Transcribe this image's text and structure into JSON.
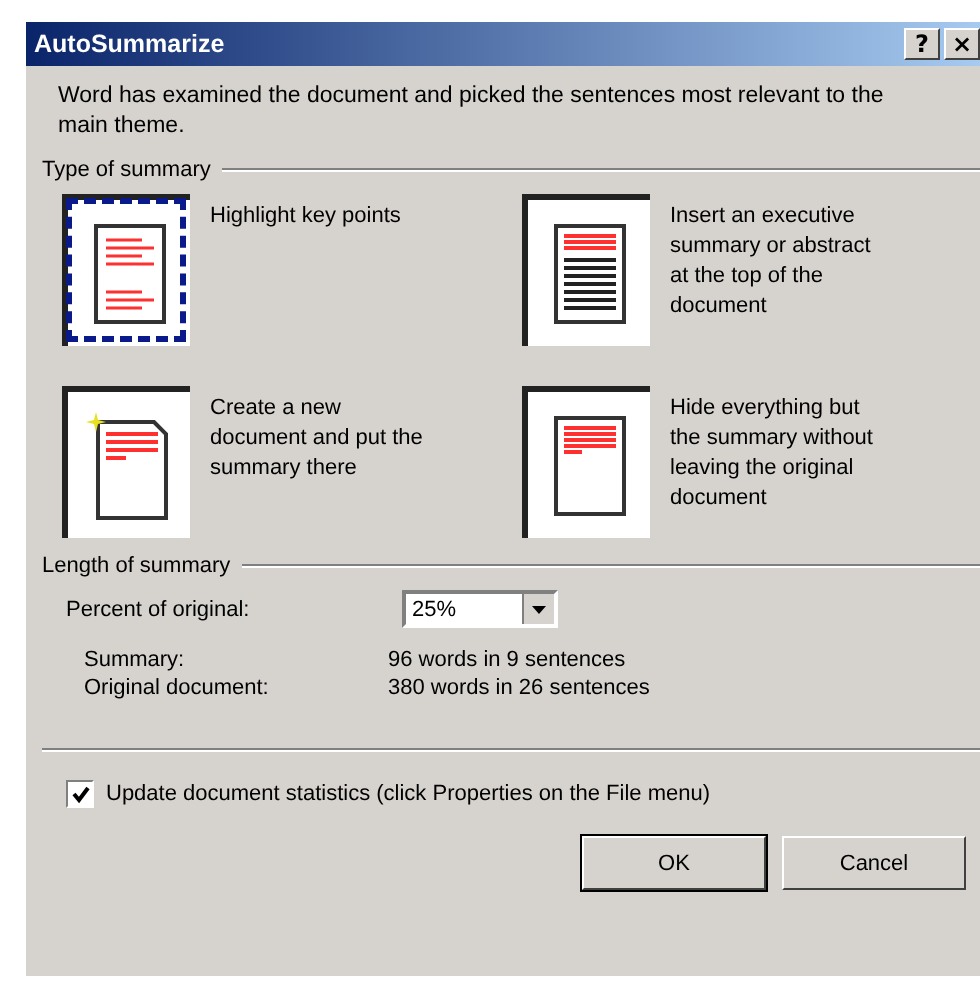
{
  "window": {
    "title": "AutoSummarize",
    "help_button": "?",
    "close_button": "×"
  },
  "intro": "Word has examined the document and picked the sentences most relevant to the main theme.",
  "type_of_summary": {
    "title": "Type of summary",
    "options": [
      {
        "kind": "highlight",
        "label": "Highlight key points",
        "selected": true
      },
      {
        "kind": "executive",
        "label": "Insert an executive summary or abstract at the top of the document",
        "selected": false
      },
      {
        "kind": "new-document",
        "label": "Create a new document and put the summary there",
        "selected": false
      },
      {
        "kind": "hide",
        "label": "Hide everything but the summary without leaving the original document",
        "selected": false
      }
    ]
  },
  "length_of_summary": {
    "title": "Length of summary",
    "percent_label": "Percent of original:",
    "percent_value": "25%",
    "stats": [
      {
        "label": "Summary:",
        "value": "96 words in 9 sentences"
      },
      {
        "label": "Original document:",
        "value": "380 words in 26 sentences"
      }
    ]
  },
  "update_statistics": {
    "label": "Update document statistics (click Properties on the File menu)",
    "checked": true
  },
  "buttons": [
    {
      "label": "OK",
      "default": true
    },
    {
      "label": "Cancel",
      "default": false
    }
  ]
}
